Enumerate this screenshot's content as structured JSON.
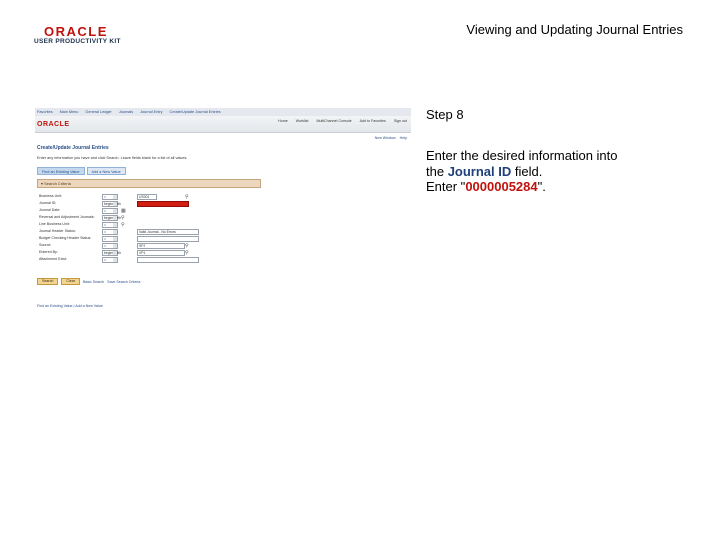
{
  "header": {
    "logo_brand": "ORACLE",
    "logo_product": "USER PRODUCTIVITY KIT",
    "title": "Viewing and Updating Journal Entries"
  },
  "screenshot": {
    "menu_items": [
      "Favorites",
      "Main Menu",
      "General Ledger",
      "Journals",
      "Journal Entry",
      "Create/Update Journal Entries"
    ],
    "brand": "ORACLE",
    "top_links": [
      "Home",
      "Worklist",
      "MultiChannel Console",
      "Add to Favorites",
      "Sign out"
    ],
    "sub_links": [
      "New Window",
      "Help"
    ],
    "heading": "Create/Update Journal Entries",
    "instructions": "Enter any information you have and click Search. Leave fields blank for a list of all values.",
    "tabs": [
      "Find an Existing Value",
      "Add a New Value"
    ],
    "criteria_label": "Search Criteria",
    "rows": [
      {
        "label": "Business Unit:",
        "op": "=",
        "value": "US001"
      },
      {
        "label": "Journal ID:",
        "op": "begins with",
        "value": ""
      },
      {
        "label": "Journal Date:",
        "op": "=",
        "value": ""
      },
      {
        "label": "Reversal and Adjustment Journals:",
        "op": "begins with",
        "value": ""
      },
      {
        "label": "Line Business Unit:",
        "op": "=",
        "value": ""
      },
      {
        "label": "Journal Header Status:",
        "op": "=",
        "value": "Valid Journal - No Errors"
      },
      {
        "label": "Budget Checking Header Status:",
        "op": "=",
        "value": ""
      },
      {
        "label": "Source:",
        "op": "=",
        "value": "SPJ"
      },
      {
        "label": "Entered By:",
        "op": "begins with",
        "value": "VP1"
      },
      {
        "label": "Attachment Exist:",
        "op": "=",
        "value": ""
      }
    ],
    "buttons": [
      "Search",
      "Clear"
    ],
    "links": [
      "Basic Search",
      "Save Search Criteria"
    ],
    "footer": "Find an Existing Value | Add a New Value"
  },
  "panel": {
    "step": "Step 8",
    "line1_pre": "Enter the desired information into",
    "line2_pre": "the ",
    "field_name": "Journal ID",
    "line2_post": " field.",
    "line3_pre": "Enter \"",
    "value": "0000005284",
    "line3_post": "\"."
  },
  "colors": {
    "oracle_red": "#c0120c",
    "field_highlight": "#d21d12",
    "link_blue": "#2a4f8a"
  }
}
